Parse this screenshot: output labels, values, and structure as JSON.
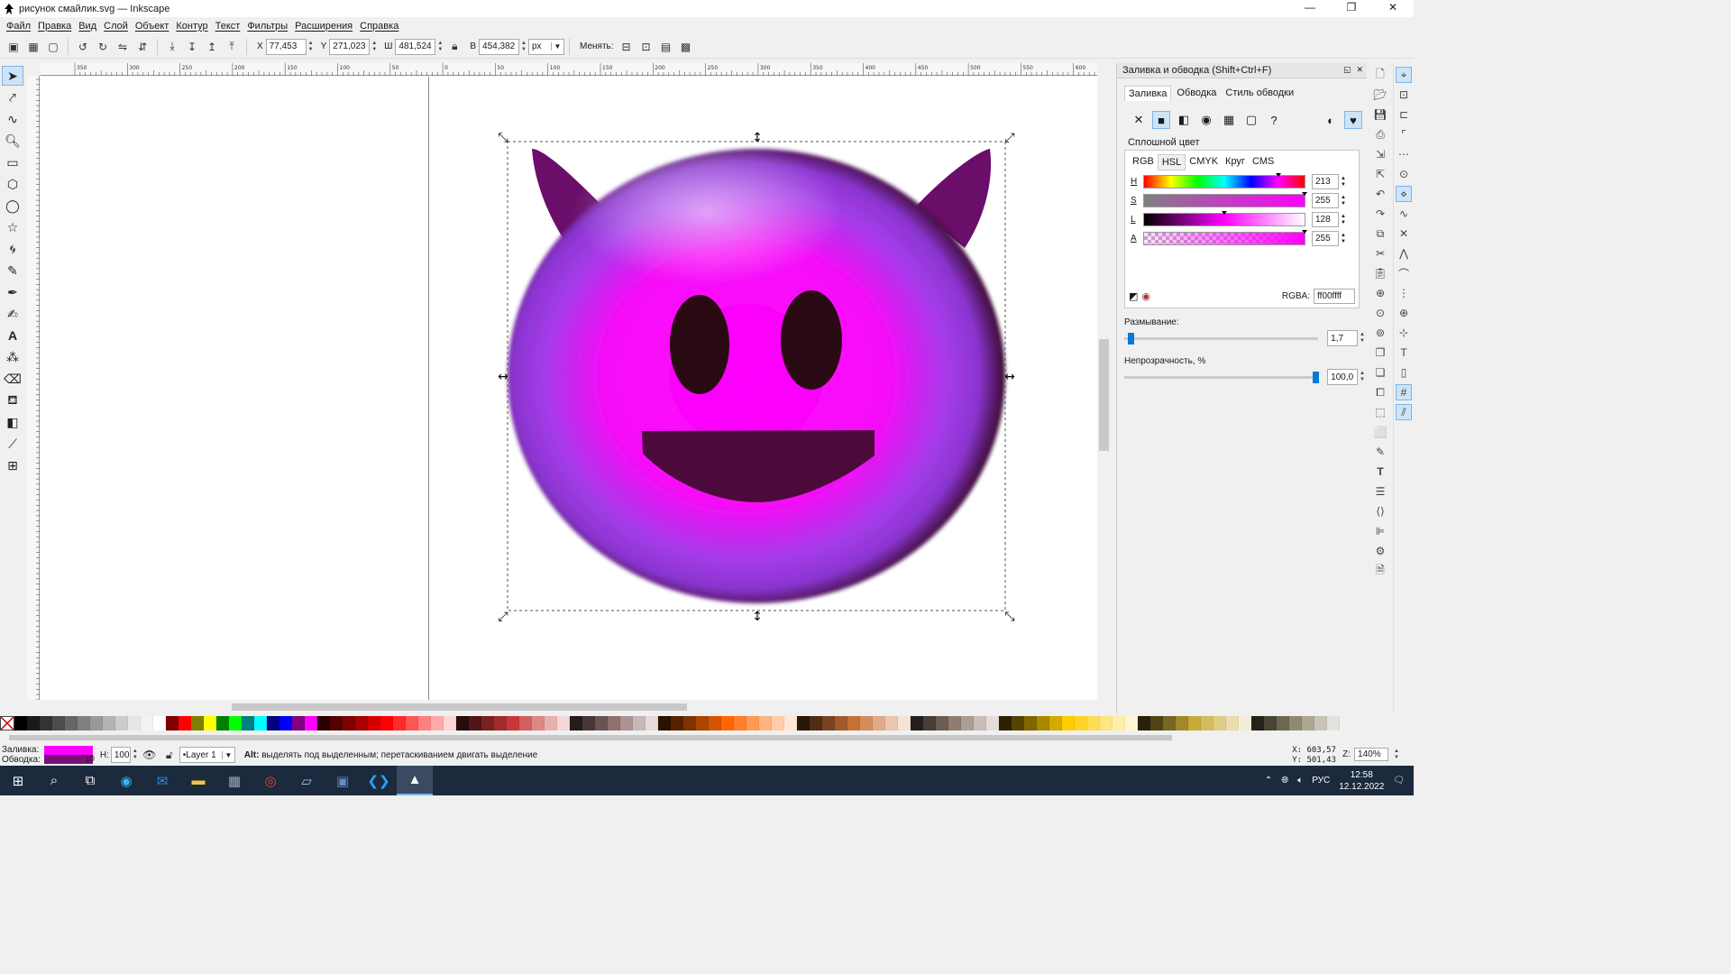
{
  "window": {
    "title": "рисунок смайлик.svg — Inkscape",
    "minimize": "—",
    "maximize": "❐",
    "close": "✕"
  },
  "menu": [
    "Файл",
    "Правка",
    "Вид",
    "Слой",
    "Объект",
    "Контур",
    "Текст",
    "Фильтры",
    "Расширения",
    "Справка"
  ],
  "toolbar": {
    "x_label": "X",
    "x_value": "77,453",
    "y_label": "Y",
    "y_value": "271,023",
    "w_label": "Ш",
    "w_value": "481,524",
    "h_label": "В",
    "h_value": "454,382",
    "unit": "px",
    "transform_label": "Менять:"
  },
  "ruler": {
    "top_ticks": [
      "350",
      "300",
      "250",
      "200",
      "150",
      "100",
      "50",
      "0",
      "50",
      "100",
      "150",
      "200",
      "250",
      "300",
      "350",
      "400",
      "450",
      "500",
      "550",
      "600"
    ]
  },
  "fill_stroke": {
    "title": "Заливка и обводка (Shift+Ctrl+F)",
    "tabs": [
      "Заливка",
      "Обводка",
      "Стиль обводки"
    ],
    "flat_label": "Сплошной цвет",
    "color_tabs": [
      "RGB",
      "HSL",
      "CMYK",
      "Круг",
      "CMS"
    ],
    "active_color_tab": "HSL",
    "sliders": [
      {
        "label": "H",
        "value": "213"
      },
      {
        "label": "S",
        "value": "255"
      },
      {
        "label": "L",
        "value": "128"
      },
      {
        "label": "A",
        "value": "255"
      }
    ],
    "slider_levels": {
      "H": 0.835,
      "S": 1.0,
      "L": 0.5,
      "A": 1.0
    },
    "rgba_label": "RGBA:",
    "rgba_value": "ff00ffff",
    "blur_label": "Размывание:",
    "blur_value": "1,7",
    "opacity_label": "Непрозрачность, %",
    "opacity_value": "100,0"
  },
  "status": {
    "fill_label": "Заливка:",
    "stroke_label": "Обводка:",
    "fill_color": "#ff00ff",
    "stroke_color": "#7a0f7a",
    "stroke_width": "10",
    "opacity_label": "Н:",
    "opacity_value": "100",
    "layer": "•Layer 1",
    "message_bold": "Alt:",
    "message": " выделять под выделенным; перетаскиванием двигать выделение",
    "coord_x": "X:   603,57",
    "coord_y": "Y:   501,43",
    "zoom_label": "Z:",
    "zoom_value": "140%"
  },
  "taskbar": {
    "lang": "РУС",
    "time": "12:58",
    "date": "12.12.2022"
  },
  "palette_colors": [
    "#000000",
    "#1a1a1a",
    "#333333",
    "#4d4d4d",
    "#666666",
    "#808080",
    "#999999",
    "#b3b3b3",
    "#cccccc",
    "#e6e6e6",
    "#f2f2f2",
    "#ffffff",
    "#800000",
    "#ff0000",
    "#808000",
    "#ffff00",
    "#008000",
    "#00ff00",
    "#008080",
    "#00ffff",
    "#000080",
    "#0000ff",
    "#800080",
    "#ff00ff",
    "#2b0000",
    "#550000",
    "#800000",
    "#aa0000",
    "#d40000",
    "#ff0000",
    "#ff2a2a",
    "#ff5555",
    "#ff8080",
    "#ffaaaa",
    "#ffd5d5",
    "#280b0b",
    "#501616",
    "#782121",
    "#a02c2c",
    "#c83737",
    "#d35f5f",
    "#de8787",
    "#e9afaf",
    "#f4d7d7",
    "#241c1c",
    "#483737",
    "#6c5353",
    "#916f6f",
    "#ac9393",
    "#c8b7b7",
    "#e3dbdb",
    "#2b1100",
    "#552200",
    "#803300",
    "#aa4400",
    "#d45500",
    "#ff6600",
    "#ff7f2a",
    "#ff9955",
    "#ffb380",
    "#ffccaa",
    "#ffe6d5",
    "#28170b",
    "#502d16",
    "#784421",
    "#a05a2c",
    "#c87137",
    "#d38d5f",
    "#deaa87",
    "#e9c6af",
    "#f4e3d7",
    "#241f1c",
    "#483e37",
    "#6c5d53",
    "#917c6f",
    "#ac9d93",
    "#c8beb7",
    "#e3dedb",
    "#2b2200",
    "#554400",
    "#806600",
    "#aa8800",
    "#d4aa00",
    "#ffcc00",
    "#ffd42a",
    "#ffdd55",
    "#ffe680",
    "#ffeeaa",
    "#fff6d5",
    "#28220b",
    "#504416",
    "#786721",
    "#a0892c",
    "#c8ab37",
    "#d3bc5f",
    "#decd87",
    "#e9ddaf",
    "#f4eed7",
    "#24221c",
    "#484537",
    "#6c6753",
    "#918a6f",
    "#aca793",
    "#c8c4b7",
    "#e3e2db"
  ]
}
